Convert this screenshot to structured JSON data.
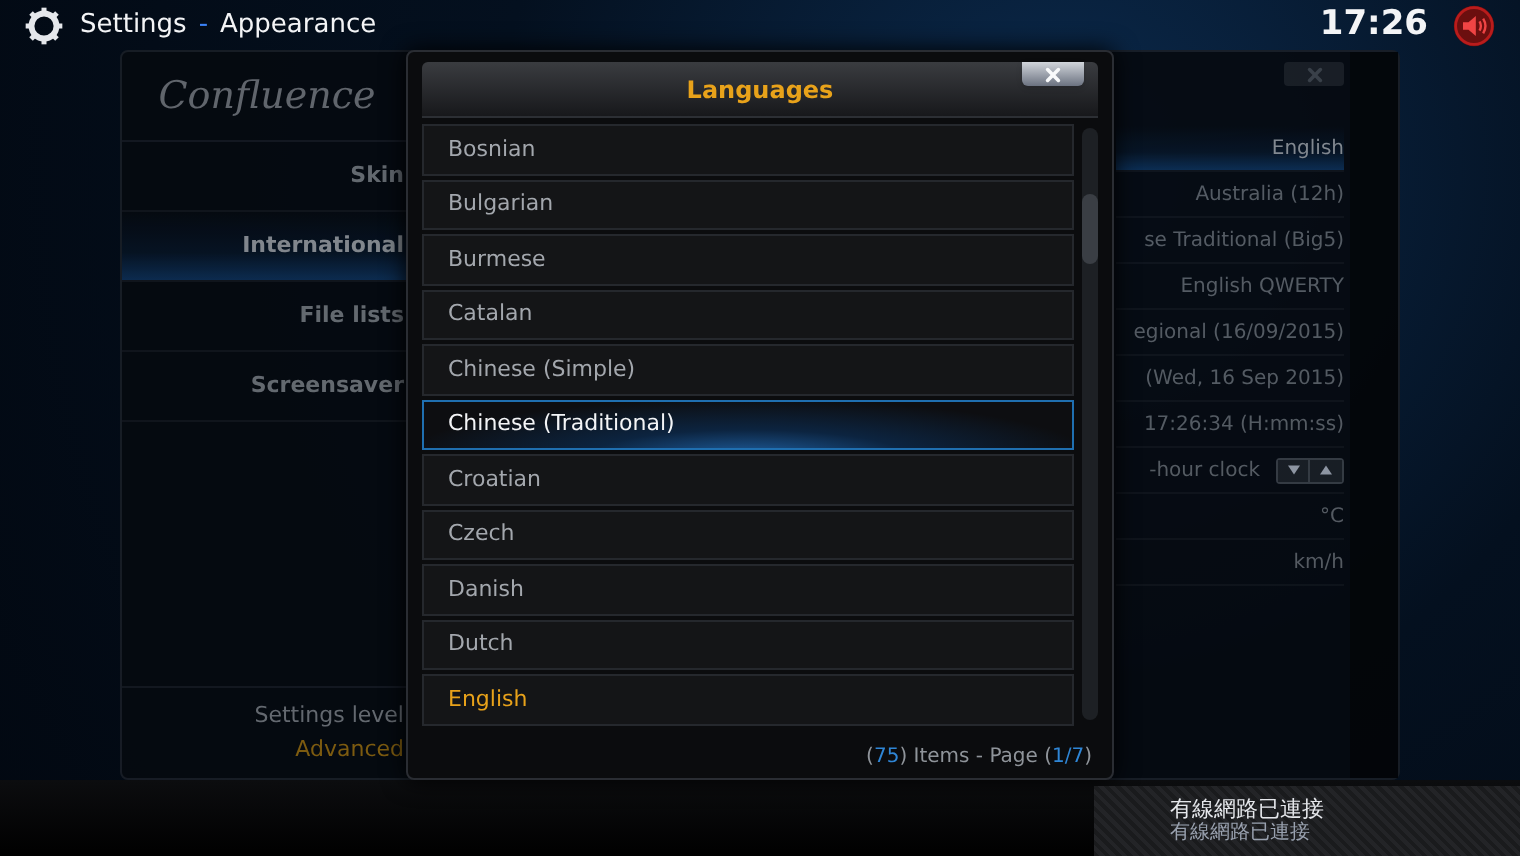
{
  "header": {
    "section": "Settings",
    "separator": "-",
    "page": "Appearance",
    "clock": "17:26",
    "muted": true
  },
  "sidebar": {
    "logo": "Confluence",
    "items": [
      {
        "label": "Skin",
        "selected": false
      },
      {
        "label": "International",
        "selected": true
      },
      {
        "label": "File lists",
        "selected": false
      },
      {
        "label": "Screensaver",
        "selected": false
      }
    ],
    "settings_level": {
      "label": "Settings level",
      "value": "Advanced"
    }
  },
  "settings": {
    "rows": [
      {
        "value": "English",
        "kind": "text",
        "selected": true
      },
      {
        "value": "Australia (12h)",
        "kind": "text",
        "selected": false
      },
      {
        "value": "se Traditional (Big5)",
        "kind": "text",
        "selected": false
      },
      {
        "value": "English QWERTY",
        "kind": "text",
        "selected": false
      },
      {
        "value": "egional (16/09/2015)",
        "kind": "text",
        "selected": false
      },
      {
        "value": "(Wed, 16 Sep 2015)",
        "kind": "text",
        "selected": false
      },
      {
        "value": "17:26:34 (H:mm:ss)",
        "kind": "text",
        "selected": false
      },
      {
        "value": "-hour clock",
        "kind": "spinner",
        "selected": false
      },
      {
        "value": "°C",
        "kind": "text",
        "selected": false
      },
      {
        "value": "km/h",
        "kind": "text",
        "selected": false
      }
    ]
  },
  "dialog": {
    "title": "Languages",
    "items": [
      {
        "label": "Bosnian",
        "selected": false,
        "current": false
      },
      {
        "label": "Bulgarian",
        "selected": false,
        "current": false
      },
      {
        "label": "Burmese",
        "selected": false,
        "current": false
      },
      {
        "label": "Catalan",
        "selected": false,
        "current": false
      },
      {
        "label": "Chinese (Simple)",
        "selected": false,
        "current": false
      },
      {
        "label": "Chinese (Traditional)",
        "selected": true,
        "current": false
      },
      {
        "label": "Croatian",
        "selected": false,
        "current": false
      },
      {
        "label": "Czech",
        "selected": false,
        "current": false
      },
      {
        "label": "Danish",
        "selected": false,
        "current": false
      },
      {
        "label": "Dutch",
        "selected": false,
        "current": false
      },
      {
        "label": "English",
        "selected": false,
        "current": true
      }
    ],
    "footer": [
      {
        "text": "(",
        "kind": "plain"
      },
      {
        "text": "75",
        "kind": "number"
      },
      {
        "text": ") Items - Page (",
        "kind": "plain"
      },
      {
        "text": "1/7",
        "kind": "number"
      },
      {
        "text": ")",
        "kind": "plain"
      }
    ]
  },
  "notification": {
    "title": "有線網路已連接",
    "message": "有線網路已連接"
  }
}
